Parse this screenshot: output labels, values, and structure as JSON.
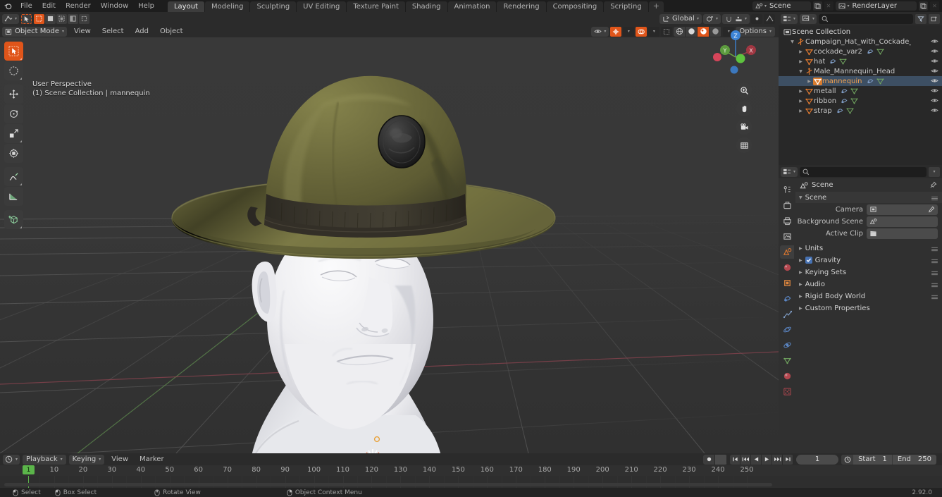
{
  "app": {
    "name": "Blender",
    "version": "2.92.0"
  },
  "topbar": {
    "menus": [
      "File",
      "Edit",
      "Render",
      "Window",
      "Help"
    ],
    "workspace_tabs": [
      {
        "label": "Layout",
        "active": true
      },
      {
        "label": "Modeling",
        "active": false
      },
      {
        "label": "Sculpting",
        "active": false
      },
      {
        "label": "UV Editing",
        "active": false
      },
      {
        "label": "Texture Paint",
        "active": false
      },
      {
        "label": "Shading",
        "active": false
      },
      {
        "label": "Animation",
        "active": false
      },
      {
        "label": "Rendering",
        "active": false
      },
      {
        "label": "Compositing",
        "active": false
      },
      {
        "label": "Scripting",
        "active": false
      }
    ],
    "add_tab_label": "+",
    "scene_name": "Scene",
    "view_layer_name": "RenderLayer"
  },
  "viewport": {
    "mode": "Object Mode",
    "menus": [
      "View",
      "Select",
      "Add",
      "Object"
    ],
    "transform_orientation": "Global",
    "options_label": "Options",
    "overlay_text_line1": "User Perspective",
    "overlay_text_line2": "(1) Scene Collection | mannequin",
    "gizmo_axes": [
      "X",
      "Y",
      "Z"
    ],
    "toolbar_tools": [
      {
        "name": "tweak-tool",
        "active": true
      },
      {
        "name": "select-box-tool",
        "active": false
      },
      {
        "name": "move-tool",
        "active": false
      },
      {
        "name": "rotate-tool",
        "active": false
      },
      {
        "name": "scale-tool",
        "active": false
      },
      {
        "name": "transform-tool",
        "active": false
      },
      {
        "name": "annotate-tool",
        "active": false
      },
      {
        "name": "measure-tool",
        "active": false
      },
      {
        "name": "add-cube-tool",
        "active": false
      }
    ],
    "nav_buttons": [
      "zoom-icon",
      "hand-icon",
      "camera-icon",
      "grid-icon"
    ]
  },
  "outliner": {
    "display_mode": "View Layer",
    "search_placeholder": "",
    "rows": [
      {
        "label": "Scene Collection",
        "icon": "collection-icon",
        "indent": 0,
        "disclosure": "none",
        "selected": false,
        "modifiers": [],
        "eye": true
      },
      {
        "label": "Campaign_Hat_with_Cockade_Green_on_Ma",
        "icon": "empty-axes-icon",
        "indent": 1,
        "disclosure": "open",
        "selected": false,
        "modifiers": [],
        "eye": true
      },
      {
        "label": "cockade_var2",
        "icon": "mesh-data-icon",
        "indent": 2,
        "disclosure": "closed",
        "selected": false,
        "modifiers": [
          "modifier-icon",
          "mesh-icon"
        ],
        "eye": true
      },
      {
        "label": "hat",
        "icon": "mesh-data-icon",
        "indent": 2,
        "disclosure": "closed",
        "selected": false,
        "modifiers": [
          "modifier-icon",
          "mesh-icon"
        ],
        "eye": true
      },
      {
        "label": "Male_Mannequin_Head",
        "icon": "empty-axes-icon",
        "indent": 2,
        "disclosure": "open",
        "selected": false,
        "modifiers": [],
        "eye": true
      },
      {
        "label": "mannequin",
        "icon": "mesh-data-icon",
        "indent": 3,
        "disclosure": "closed",
        "selected": true,
        "modifiers": [
          "modifier-icon",
          "mesh-icon"
        ],
        "eye": true
      },
      {
        "label": "metall",
        "icon": "mesh-data-icon",
        "indent": 2,
        "disclosure": "closed",
        "selected": false,
        "modifiers": [
          "modifier-icon",
          "mesh-icon"
        ],
        "eye": true
      },
      {
        "label": "ribbon",
        "icon": "mesh-data-icon",
        "indent": 2,
        "disclosure": "closed",
        "selected": false,
        "modifiers": [
          "modifier-icon",
          "mesh-icon"
        ],
        "eye": true
      },
      {
        "label": "strap",
        "icon": "mesh-data-icon",
        "indent": 2,
        "disclosure": "closed",
        "selected": false,
        "modifiers": [
          "modifier-icon",
          "mesh-icon"
        ],
        "eye": true
      }
    ]
  },
  "properties": {
    "breadcrumb": "Scene",
    "active_tab": "scene-properties",
    "tabs": [
      "tool-icon",
      "render-icon",
      "output-icon",
      "view-layer-icon",
      "scene-icon",
      "world-icon",
      "object-icon",
      "modifier-icon",
      "particles-icon",
      "physics-icon",
      "constraints-icon",
      "data-icon",
      "material-icon",
      "texture-icon"
    ],
    "scene_panel": {
      "title": "Scene",
      "rows": [
        {
          "label": "Camera",
          "value": "",
          "icon": "camera-icon"
        },
        {
          "label": "Background Scene",
          "value": "",
          "icon": "scene-icon"
        },
        {
          "label": "Active Clip",
          "value": "",
          "icon": "clip-icon"
        }
      ]
    },
    "collapsed_panels": [
      {
        "label": "Units",
        "checkbox": null
      },
      {
        "label": "Gravity",
        "checkbox": true
      },
      {
        "label": "Keying Sets",
        "checkbox": null
      },
      {
        "label": "Audio",
        "checkbox": null
      },
      {
        "label": "Rigid Body World",
        "checkbox": null
      },
      {
        "label": "Custom Properties",
        "checkbox": null
      }
    ]
  },
  "timeline": {
    "playback_label": "Playback",
    "keying_label": "Keying",
    "menus": [
      "View",
      "Marker"
    ],
    "current_frame": "1",
    "start_label": "Start",
    "start_value": "1",
    "end_label": "End",
    "end_value": "250",
    "ruler_ticks": [
      "10",
      "20",
      "30",
      "40",
      "50",
      "60",
      "70",
      "80",
      "90",
      "100",
      "110",
      "120",
      "130",
      "140",
      "150",
      "160",
      "170",
      "180",
      "190",
      "200",
      "210",
      "220",
      "230",
      "240",
      "250"
    ],
    "playhead_label": "1"
  },
  "statusbar": {
    "items": [
      {
        "icon": "mouse-left-icon",
        "label": "Select"
      },
      {
        "icon": "mouse-left-drag-icon",
        "label": "Box Select"
      },
      {
        "icon": "mouse-middle-icon",
        "label": "Rotate View"
      },
      {
        "icon": "mouse-right-icon",
        "label": "Object Context Menu"
      }
    ],
    "version": "2.92.0"
  },
  "colors": {
    "accent_orange": "#e0551a",
    "select_blue": "#4772b3",
    "timeline_green": "#5bb54a",
    "axis_x_red": "#d6455a",
    "axis_y_green": "#77bb41",
    "axis_z_blue": "#3d84d6",
    "hat_olive": "#6d6c3c",
    "mannequin_white": "#e8e8ea"
  }
}
